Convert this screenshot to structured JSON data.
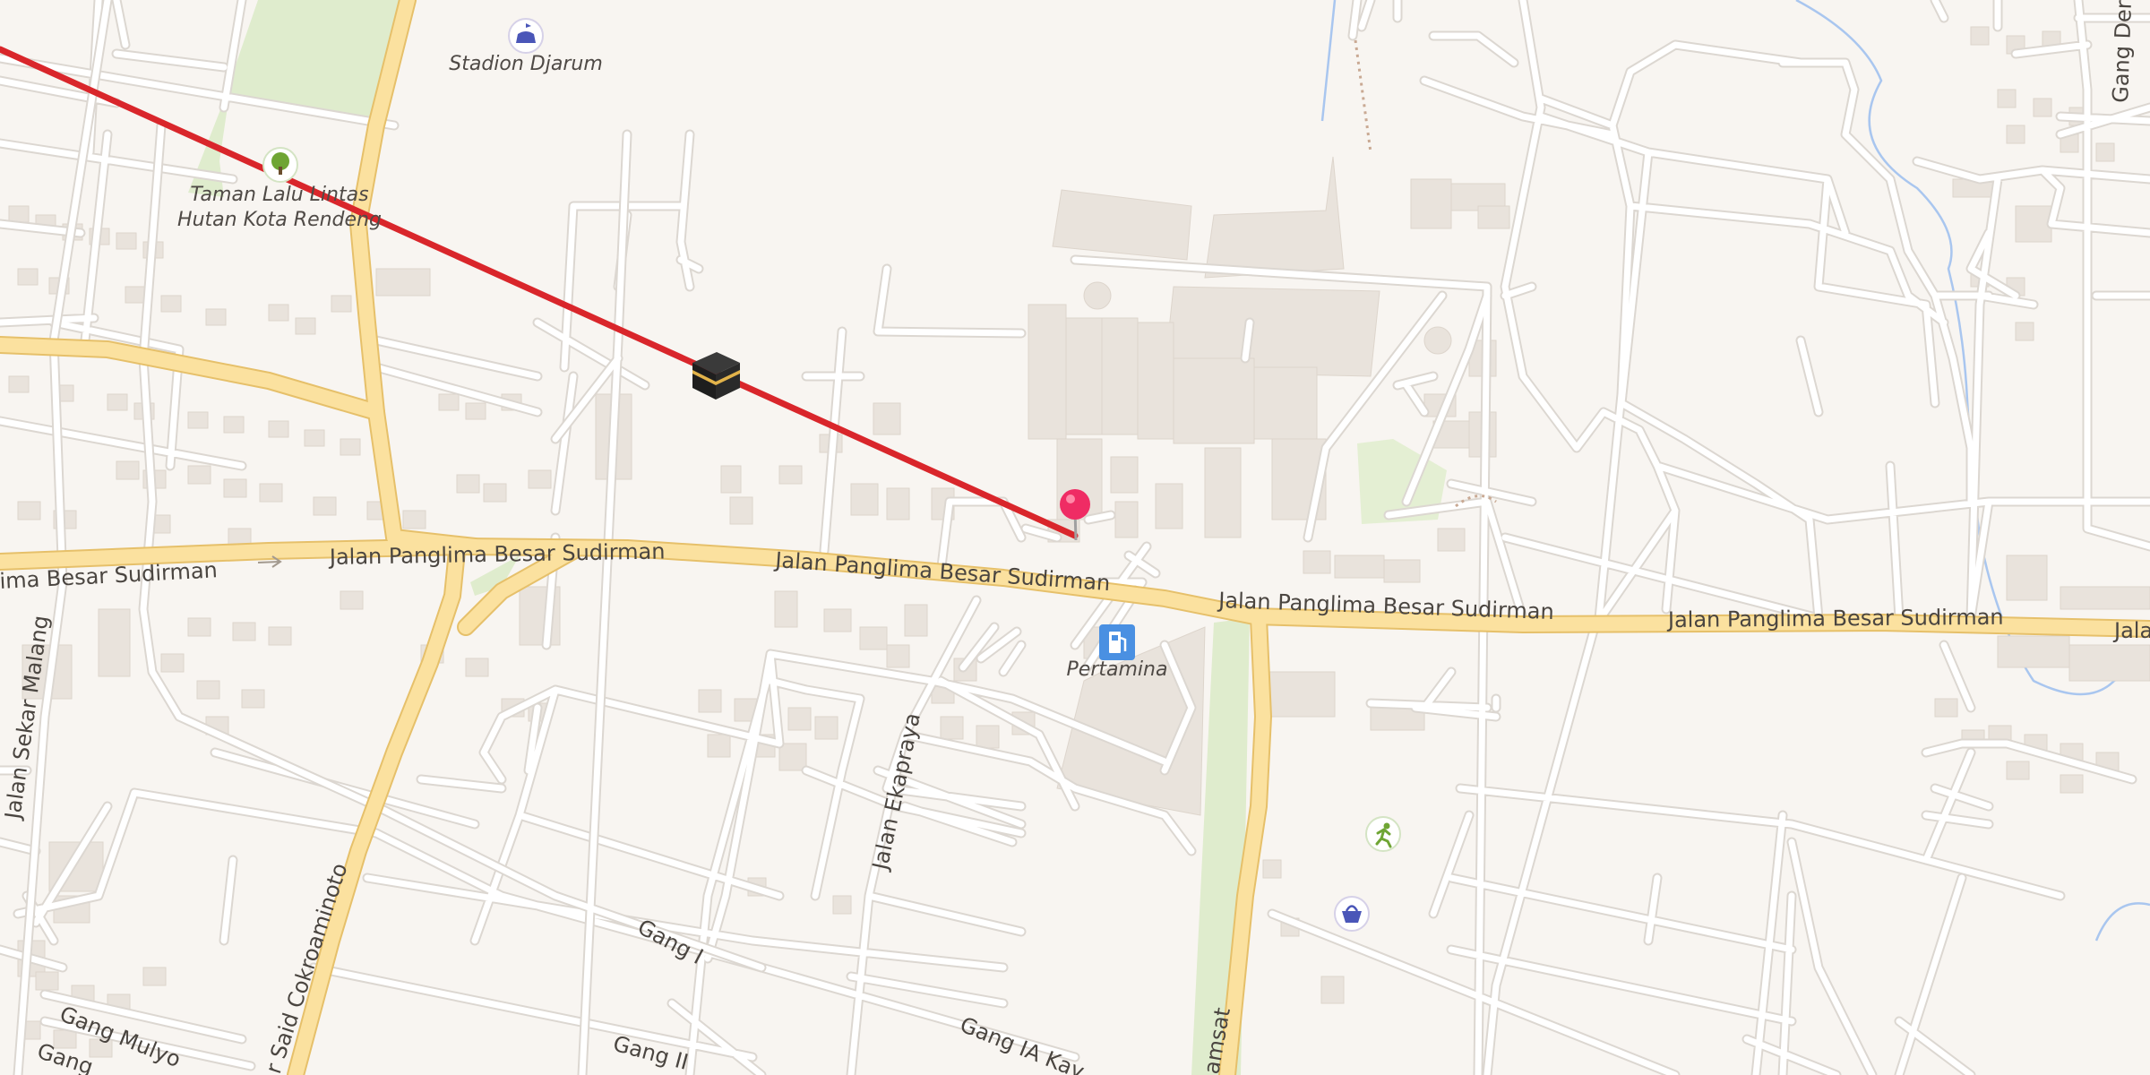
{
  "map": {
    "colors": {
      "background": "#f8f5f1",
      "minor_road": "#ffffff",
      "minor_road_casing": "#dcd7d1",
      "major_road": "#fbe19f",
      "major_road_casing": "#e6c06a",
      "building": "#e9e3dc",
      "park": "#dfeccd",
      "water": "#a9c6ef",
      "route_line": "#d9262b",
      "pin": "#ef2c64"
    },
    "road_labels": {
      "main_road_left": "ima Besar Sudirman",
      "main_road_1": "Jalan Panglima Besar Sudirman",
      "main_road_2": "Jalan Panglima Besar Sudirman",
      "main_road_3": "Jalan Panglima Besar Sudirman",
      "main_road_4": "Jalan Panglima Besar Sudirman",
      "main_road_right": "Jala",
      "sekar_malang": "Jalan Sekar Malang",
      "said_cokroaminoto": "r Said Cokroaminoto",
      "ekapraya": "Jalan Ekapraya",
      "gang_i": "Gang I",
      "gang_ii": "Gang II",
      "gang_mulyo": "Gang Mulyo",
      "gang_left": "Gang",
      "gang_ia": "Gang IA Kay",
      "samsat": "amsat",
      "gang_dera": "Gang Dera"
    },
    "pois": {
      "stadium": {
        "label": "Stadion Djarum",
        "icon": "stadium-icon"
      },
      "park": {
        "label_line1": "Taman Lalu Lintas",
        "label_line2": "Hutan Kota Rendeng",
        "icon": "tree-icon"
      },
      "fuel": {
        "label": "Pertamina",
        "icon": "fuel-pump-icon"
      },
      "sport": {
        "icon": "running-person-icon"
      },
      "shop": {
        "icon": "shopping-basket-icon"
      }
    },
    "markers": {
      "qibla": {
        "icon": "kaaba-icon"
      },
      "location": {
        "icon": "location-pin-icon"
      }
    }
  }
}
